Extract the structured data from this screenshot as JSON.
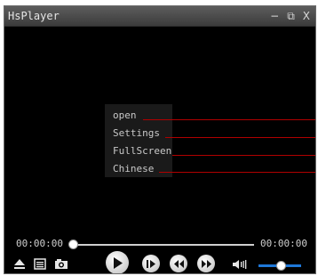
{
  "window": {
    "title": "HsPlayer",
    "minimize_glyph": "−",
    "restore_glyph": "⧉",
    "close_glyph": "X"
  },
  "context_menu": {
    "items": [
      {
        "label": "open"
      },
      {
        "label": "Settings"
      },
      {
        "label": "FullScreen"
      },
      {
        "label": "Chinese"
      }
    ]
  },
  "playback": {
    "current_time": "00:00:00",
    "total_time": "00:00:00",
    "progress": 0,
    "volume": 0.5
  },
  "icons": {
    "eject": "eject-icon",
    "playlist": "playlist-icon",
    "snapshot": "camera-icon",
    "play": "play-icon",
    "step": "step-forward-icon",
    "rewind": "rewind-icon",
    "forward": "fast-forward-icon",
    "volume": "speaker-icon"
  },
  "colors": {
    "annotation_line": "#b00000",
    "volume_bar": "#1e78d8",
    "titlebar": "#4a4a4a"
  }
}
